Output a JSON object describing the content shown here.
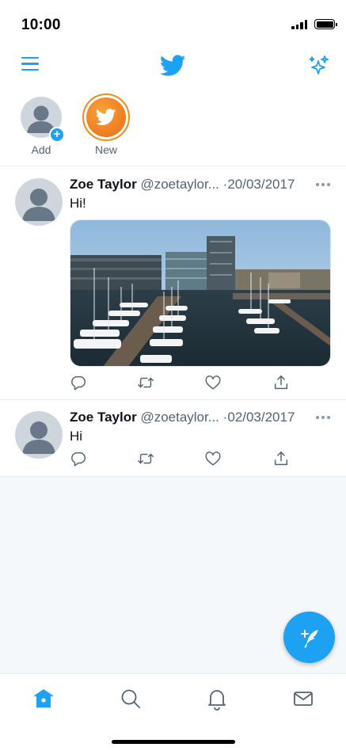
{
  "status_bar": {
    "time": "10:00",
    "icons": [
      "signal-icon",
      "battery-icon"
    ]
  },
  "top_bar": {
    "menu_icon": "hamburger-menu-icon",
    "logo_icon": "twitter-bird-icon",
    "action_icon": "sparkle-icon"
  },
  "fleets": [
    {
      "label": "Add",
      "icon": "plus-icon"
    },
    {
      "label": "New",
      "icon": "twitter-bird-icon"
    }
  ],
  "tweets": [
    {
      "name": "Zoe Taylor",
      "handle": "@zoetaylor...",
      "separator": "·",
      "date": "20/03/2017",
      "text": "Hi!",
      "has_media": true,
      "media_description": "harbor-photo",
      "actions": [
        "reply-icon",
        "retweet-icon",
        "like-icon",
        "share-icon"
      ]
    },
    {
      "name": "Zoe Taylor",
      "handle": "@zoetaylor...",
      "separator": "·",
      "date": "02/03/2017",
      "text": "Hi",
      "has_media": false,
      "actions": [
        "reply-icon",
        "retweet-icon",
        "like-icon",
        "share-icon"
      ]
    }
  ],
  "fab": {
    "icon": "compose-tweet-icon"
  },
  "tab_bar": {
    "tabs": [
      {
        "name": "home",
        "icon": "home-icon",
        "active": true
      },
      {
        "name": "search",
        "icon": "search-icon",
        "active": false
      },
      {
        "name": "notifications",
        "icon": "bell-icon",
        "active": false
      },
      {
        "name": "messages",
        "icon": "mail-icon",
        "active": false
      }
    ]
  },
  "colors": {
    "accent": "#1da1f2",
    "fleet_ring": "#f38b1c",
    "secondary_text": "#536471",
    "background_timeline": "#f5f8fa"
  }
}
